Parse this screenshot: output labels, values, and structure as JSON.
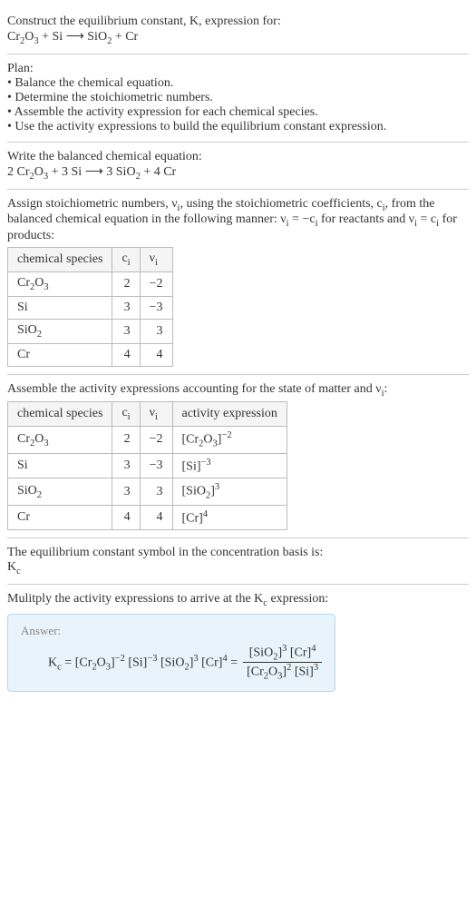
{
  "intro": {
    "line1": "Construct the equilibrium constant, K, expression for:",
    "reaction_html": "Cr<sub>2</sub>O<sub>3</sub> + Si ⟶ SiO<sub>2</sub> + Cr"
  },
  "plan": {
    "title": "Plan:",
    "items": [
      "• Balance the chemical equation.",
      "• Determine the stoichiometric numbers.",
      "• Assemble the activity expression for each chemical species.",
      "• Use the activity expressions to build the equilibrium constant expression."
    ]
  },
  "balanced": {
    "title": "Write the balanced chemical equation:",
    "reaction_html": "2 Cr<sub>2</sub>O<sub>3</sub> + 3 Si ⟶ 3 SiO<sub>2</sub> + 4 Cr"
  },
  "stoich": {
    "text_html": "Assign stoichiometric numbers, ν<sub>i</sub>, using the stoichiometric coefficients, c<sub>i</sub>, from the balanced chemical equation in the following manner: ν<sub>i</sub> = −c<sub>i</sub> for reactants and ν<sub>i</sub> = c<sub>i</sub> for products:",
    "headers": {
      "species": "chemical species",
      "ci_html": "c<sub>i</sub>",
      "vi_html": "ν<sub>i</sub>"
    },
    "rows": [
      {
        "species_html": "Cr<sub>2</sub>O<sub>3</sub>",
        "ci": "2",
        "vi": "−2"
      },
      {
        "species_html": "Si",
        "ci": "3",
        "vi": "−3"
      },
      {
        "species_html": "SiO<sub>2</sub>",
        "ci": "3",
        "vi": "3"
      },
      {
        "species_html": "Cr",
        "ci": "4",
        "vi": "4"
      }
    ]
  },
  "activity": {
    "text_html": "Assemble the activity expressions accounting for the state of matter and ν<sub>i</sub>:",
    "headers": {
      "species": "chemical species",
      "ci_html": "c<sub>i</sub>",
      "vi_html": "ν<sub>i</sub>",
      "act": "activity expression"
    },
    "rows": [
      {
        "species_html": "Cr<sub>2</sub>O<sub>3</sub>",
        "ci": "2",
        "vi": "−2",
        "act_html": "[Cr<sub>2</sub>O<sub>3</sub>]<sup>−2</sup>"
      },
      {
        "species_html": "Si",
        "ci": "3",
        "vi": "−3",
        "act_html": "[Si]<sup>−3</sup>"
      },
      {
        "species_html": "SiO<sub>2</sub>",
        "ci": "3",
        "vi": "3",
        "act_html": "[SiO<sub>2</sub>]<sup>3</sup>"
      },
      {
        "species_html": "Cr",
        "ci": "4",
        "vi": "4",
        "act_html": "[Cr]<sup>4</sup>"
      }
    ]
  },
  "basis": {
    "line1": "The equilibrium constant symbol in the concentration basis is:",
    "symbol_html": "K<sub>c</sub>"
  },
  "final": {
    "title_html": "Mulitply the activity expressions to arrive at the K<sub>c</sub> expression:",
    "answer_label": "Answer:",
    "lhs_html": "K<sub>c</sub> = [Cr<sub>2</sub>O<sub>3</sub>]<sup>−2</sup> [Si]<sup>−3</sup> [SiO<sub>2</sub>]<sup>3</sup> [Cr]<sup>4</sup> =",
    "frac_num_html": "[SiO<sub>2</sub>]<sup>3</sup> [Cr]<sup>4</sup>",
    "frac_den_html": "[Cr<sub>2</sub>O<sub>3</sub>]<sup>2</sup> [Si]<sup>3</sup>"
  }
}
